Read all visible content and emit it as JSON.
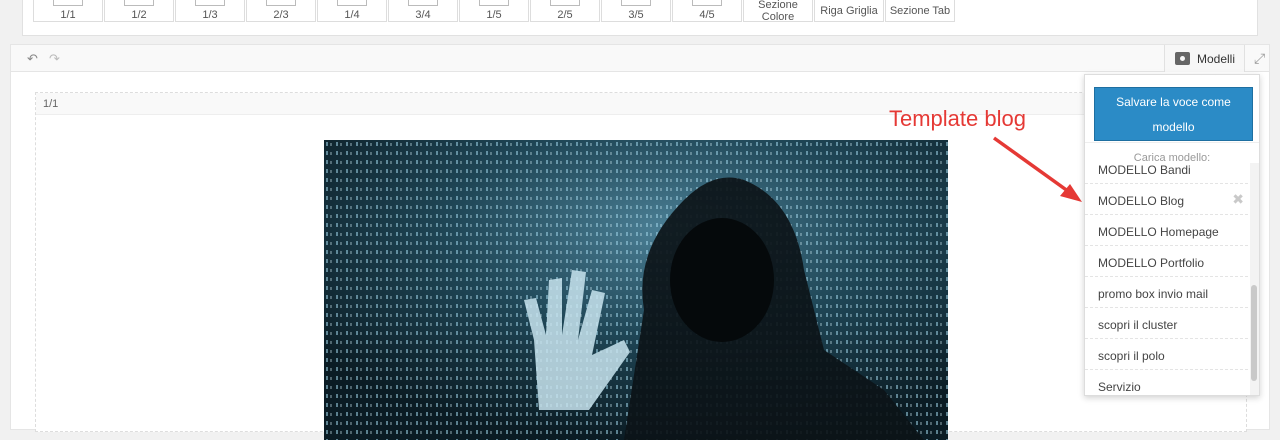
{
  "layout_buttons": [
    {
      "label": "1/1"
    },
    {
      "label": "1/2"
    },
    {
      "label": "1/3"
    },
    {
      "label": "2/3"
    },
    {
      "label": "1/4"
    },
    {
      "label": "3/4"
    },
    {
      "label": "1/5"
    },
    {
      "label": "2/5"
    },
    {
      "label": "3/5"
    },
    {
      "label": "4/5"
    }
  ],
  "section_buttons": {
    "sezione_colore": "Sezione Colore",
    "riga_griglia": "Riga Griglia",
    "sezione_tab": "Sezione Tab"
  },
  "toolbar": {
    "undo_icon": "↶",
    "redo_icon": "↷",
    "modelli_label": "Modelli",
    "fullscreen_icon": "⤢"
  },
  "row": {
    "label": "1/1"
  },
  "annotation": {
    "text": "Template blog",
    "color": "#e53935"
  },
  "templates_dropdown": {
    "save_button": "Salvare la voce come modello",
    "load_label": "Carica modello:",
    "items": [
      "MODELLO Bandi",
      "MODELLO Blog",
      "MODELLO Homepage",
      "MODELLO Portfolio",
      "promo box invio mail",
      "scopri il cluster",
      "scopri il polo",
      "Servizio"
    ],
    "delete_icon": "✖",
    "accent_color": "#2b8bc6"
  }
}
